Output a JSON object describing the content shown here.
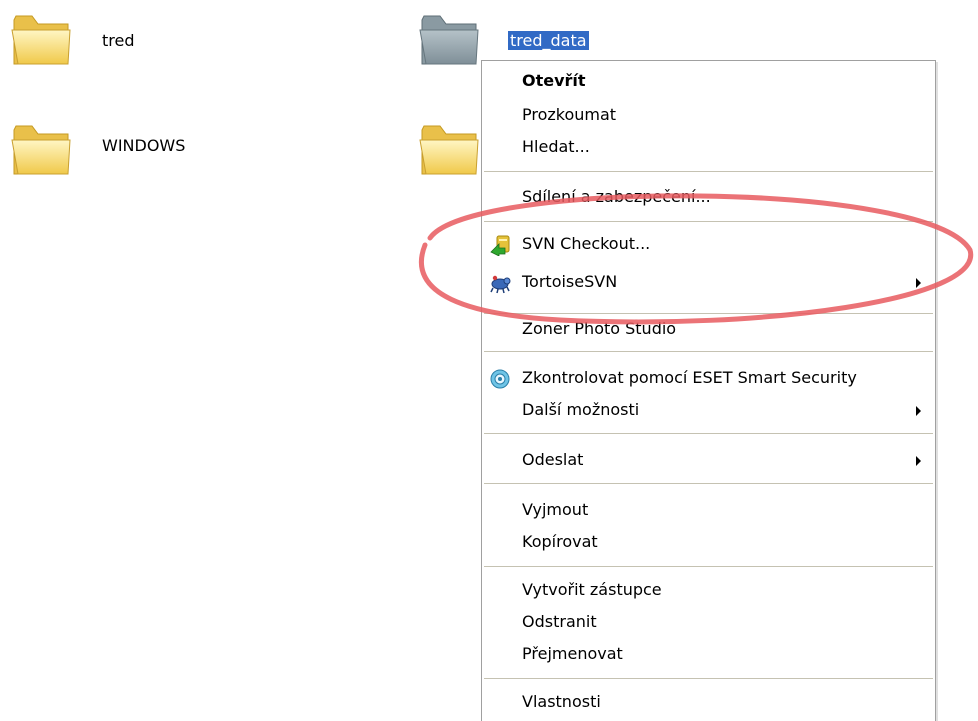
{
  "folders": [
    {
      "name": "tred"
    },
    {
      "name": "WINDOWS"
    },
    {
      "name": "tred_data"
    }
  ],
  "context_menu": {
    "items": [
      {
        "label": "Otevřít"
      },
      {
        "label": "Prozkoumat"
      },
      {
        "label": "Hledat..."
      },
      {
        "label": "Sdílení a zabezpečení..."
      },
      {
        "label": "SVN Checkout..."
      },
      {
        "label": "TortoiseSVN"
      },
      {
        "label": "Zoner Photo Studio"
      },
      {
        "label": "Zkontrolovat pomocí ESET Smart Security"
      },
      {
        "label": "Další možnosti"
      },
      {
        "label": "Odeslat"
      },
      {
        "label": "Vyjmout"
      },
      {
        "label": "Kopírovat"
      },
      {
        "label": "Vytvořit zástupce"
      },
      {
        "label": "Odstranit"
      },
      {
        "label": "Přejmenovat"
      },
      {
        "label": "Vlastnosti"
      }
    ]
  },
  "colors": {
    "selection": "#316ac5",
    "annotation": "#e85a5f"
  },
  "icons": [
    "folder-icon",
    "svn-checkout-icon",
    "tortoisesvn-icon",
    "eset-icon",
    "submenu-arrow-icon"
  ]
}
